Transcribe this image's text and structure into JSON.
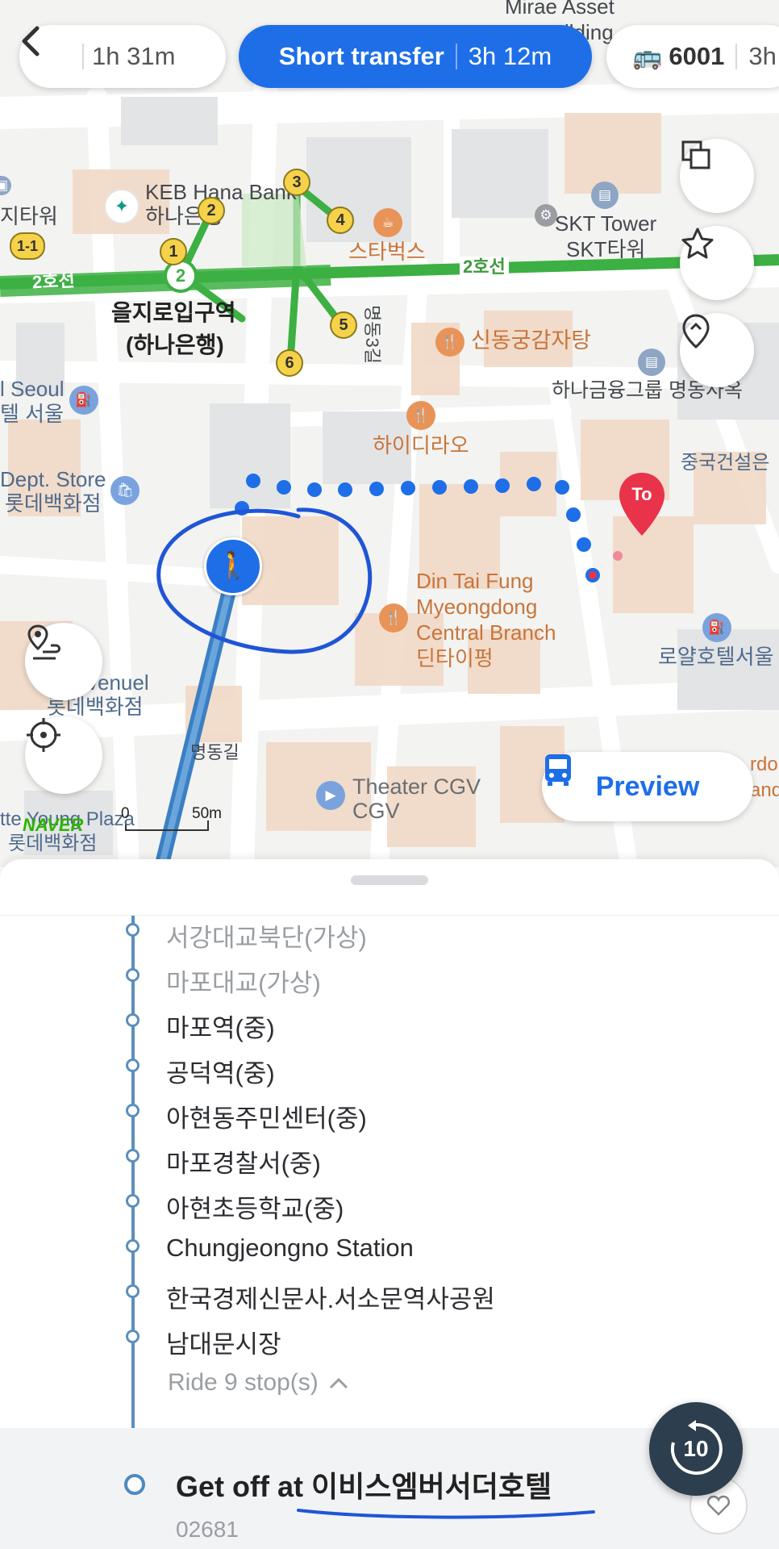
{
  "top_bar": {
    "chips": [
      {
        "label": "1h 31m"
      },
      {
        "label": "Short transfer",
        "duration": "3h 12m"
      },
      {
        "label": "6001",
        "duration": "3h"
      }
    ]
  },
  "map": {
    "labels": {
      "top_cut": "Mirae Asset",
      "top_cut2": "ilding",
      "keb_en": "KEB Hana Bank",
      "keb_ko": "하나은행",
      "left_tower": "지타워",
      "station1": "을지로입구역",
      "station2": "(하나은행)",
      "line2_left": "2호선",
      "line2_right": "2호선",
      "starbucks": "스타벅스",
      "skt_en": "SKT Tower",
      "skt_ko": "SKT타워",
      "shindong": "신동궁감자탕",
      "hana_group": "하나금융그룹 명동사옥",
      "road_3gil": "명동3길",
      "seoul_en": "l Seoul",
      "seoul_ko": "텔 서울",
      "haidilao": "하이디라오",
      "china_const": "중국건설은",
      "dept_en": "Dept. Store",
      "dept_ko": "롯데백화점",
      "dtf1": "Din Tai Fung",
      "dtf2": "Myeongdong",
      "dtf3": "Central Branch",
      "dtf4": "딘타이펑",
      "royal_hotel": "로얄호텔서울",
      "avenuel": "venuel",
      "avenuel_ko": "롯데백화점",
      "myeongdonggil": "명동길",
      "cgv1": "Theater CGV",
      "cgv2": "CGV",
      "young_plaza": "tte Young Plaza",
      "lotte_ko": "롯데백화점",
      "right_cut1": "rdon",
      "right_cut2": "and",
      "naver": "NAVER",
      "scale_zero": "0",
      "scale_len": "50m",
      "dest_pin": "To"
    },
    "exit_numbers": [
      "1-1",
      "1",
      "2",
      "3",
      "4",
      "5",
      "6"
    ],
    "station_badge": "2",
    "preview_button": "Preview",
    "colors": {
      "route_blue": "#1e6ee8",
      "line2_green": "#3cb043",
      "pin_red": "#e8334a"
    }
  },
  "sheet": {
    "stops": [
      {
        "name": "서강대교북단(가상)",
        "style": "grey"
      },
      {
        "name": "마포대교(가상)",
        "style": "grey"
      },
      {
        "name": "마포역(중)",
        "style": "dark"
      },
      {
        "name": "공덕역(중)",
        "style": "dark"
      },
      {
        "name": "아현동주민센터(중)",
        "style": "dark"
      },
      {
        "name": "마포경찰서(중)",
        "style": "dark"
      },
      {
        "name": "아현초등학교(중)",
        "style": "dark"
      },
      {
        "name": "Chungjeongno Station",
        "style": "dark"
      },
      {
        "name": "한국경제신문사.서소문역사공원",
        "style": "dark"
      },
      {
        "name": "남대문시장",
        "style": "dark"
      }
    ],
    "ride_toggle": "Ride 9 stop(s)",
    "get_off": "Get off at 이비스엠버서더호텔",
    "stop_id": "02681",
    "rewind_badge": "10"
  }
}
